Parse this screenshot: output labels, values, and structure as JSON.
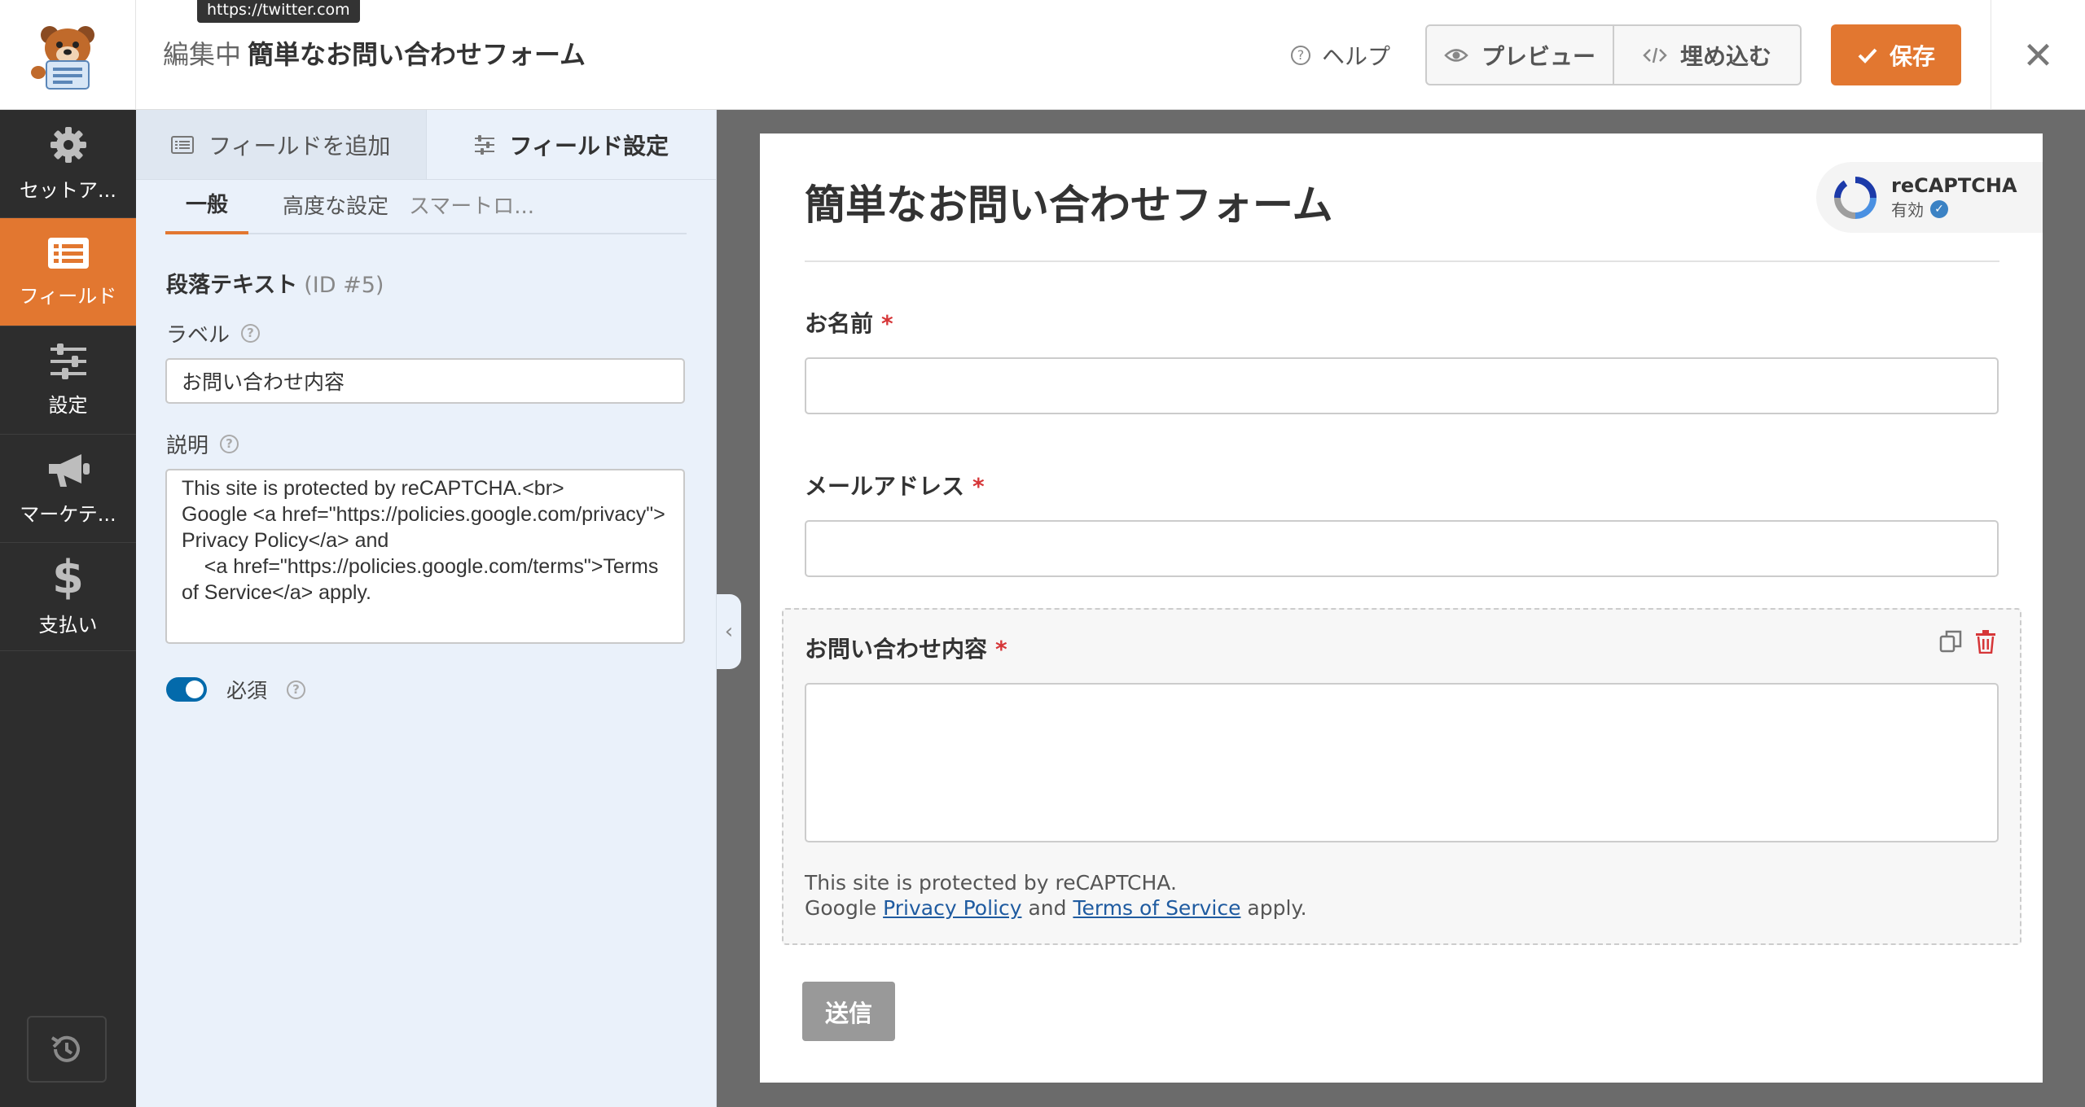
{
  "header": {
    "tooltip_url": "https://twitter.com",
    "mode_label": "編集中",
    "form_name": "簡単なお問い合わせフォーム",
    "help_label": "ヘルプ",
    "preview_label": "プレビュー",
    "embed_label": "埋め込む",
    "save_label": "保存",
    "accent_color": "#e27730"
  },
  "sidebar": {
    "items": [
      {
        "label": "セットア...",
        "icon": "gear-icon"
      },
      {
        "label": "フィールド",
        "icon": "list-icon",
        "active": true
      },
      {
        "label": "設定",
        "icon": "sliders-icon"
      },
      {
        "label": "マーケテ...",
        "icon": "megaphone-icon"
      },
      {
        "label": "支払い",
        "icon": "dollar-icon"
      }
    ],
    "history_icon": "history-icon"
  },
  "panel": {
    "tabs": [
      {
        "label": "フィールドを追加",
        "icon": "list-icon"
      },
      {
        "label": "フィールド設定",
        "icon": "sliders-icon",
        "active": true
      }
    ],
    "subtabs": [
      "一般",
      "高度な設定",
      "スマートロ..."
    ],
    "field_type": "段落テキスト",
    "field_id": "(ID #5)",
    "label_caption": "ラベル",
    "label_value": "お問い合わせ内容",
    "description_caption": "説明",
    "description_value": "This site is protected by reCAPTCHA.<br>\nGoogle <a href=\"https://policies.google.com/privacy\">Privacy Policy</a> and\n    <a href=\"https://policies.google.com/terms\">Terms of Service</a> apply.",
    "required_label": "必須",
    "required_on": true
  },
  "preview": {
    "form_title": "簡単なお問い合わせフォーム",
    "recaptcha_title": "reCAPTCHA",
    "recaptcha_status": "有効",
    "fields": [
      {
        "label": "お名前",
        "required": "*"
      },
      {
        "label": "メールアドレス",
        "required": "*"
      },
      {
        "label": "お問い合わせ内容",
        "required": "*"
      }
    ],
    "desc_line1": "This site is protected by reCAPTCHA.",
    "desc_google": "Google",
    "desc_privacy": "Privacy Policy",
    "desc_and": "and",
    "desc_terms": "Terms of Service",
    "desc_apply": "apply.",
    "submit_label": "送信"
  }
}
